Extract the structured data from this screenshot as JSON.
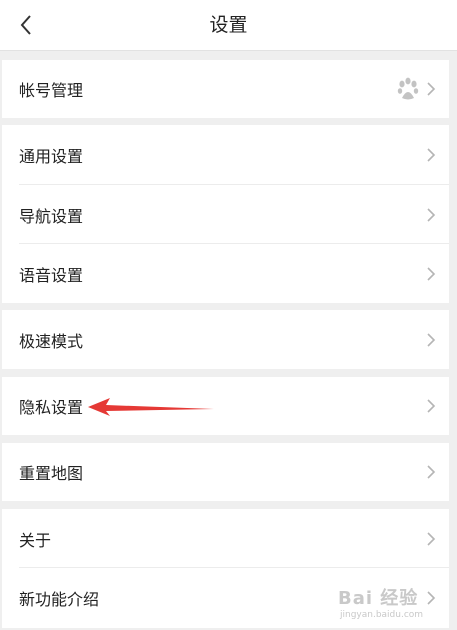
{
  "header": {
    "title": "设置"
  },
  "groups": [
    {
      "items": [
        {
          "label": "帐号管理",
          "trailing_icon": "baidu-paw-icon"
        }
      ]
    },
    {
      "items": [
        {
          "label": "通用设置"
        },
        {
          "label": "导航设置"
        },
        {
          "label": "语音设置"
        }
      ]
    },
    {
      "items": [
        {
          "label": "极速模式"
        }
      ]
    },
    {
      "items": [
        {
          "label": "隐私设置"
        }
      ]
    },
    {
      "items": [
        {
          "label": "重置地图"
        }
      ]
    },
    {
      "items": [
        {
          "label": "关于"
        },
        {
          "label": "新功能介绍"
        }
      ]
    }
  ],
  "annotation": {
    "type": "red-arrow",
    "points_to": "隐私设置",
    "color": "#e53935"
  },
  "watermark": {
    "text": "Bai 经验",
    "url": "jingyan.baidu.com"
  },
  "colors": {
    "background": "#efefef",
    "row": "#ffffff",
    "chevron": "#b5b5b5",
    "text": "#222222"
  }
}
